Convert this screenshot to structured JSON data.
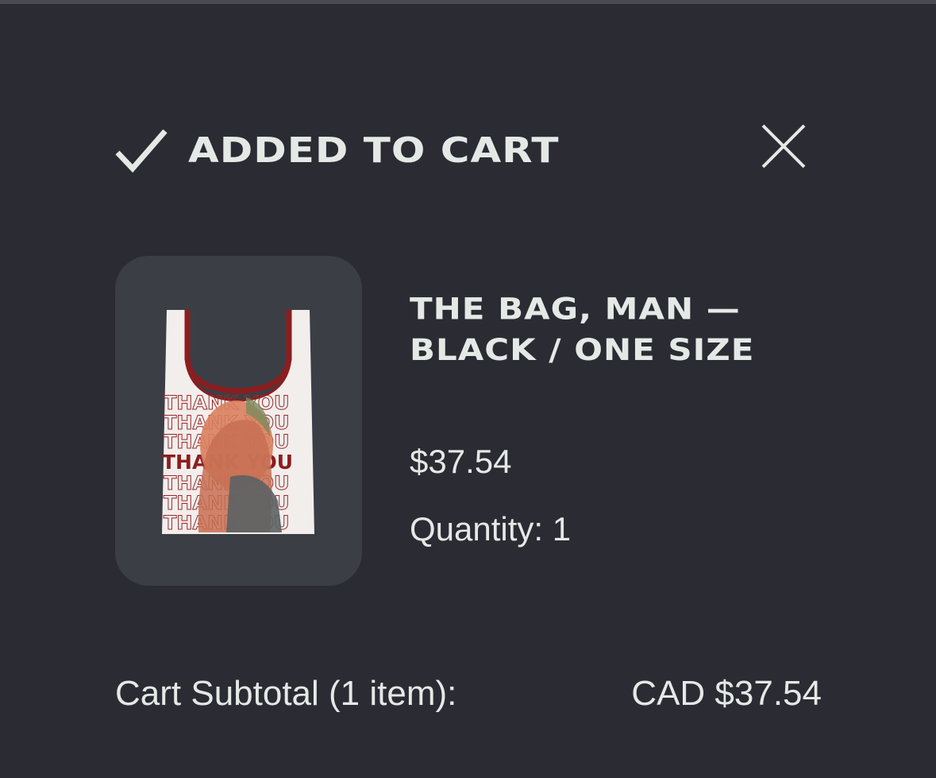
{
  "header": {
    "title": "ADDED TO CART",
    "check_icon": "checkmark-icon",
    "close_icon": "close-icon"
  },
  "product": {
    "image_alt": "Thank You tote bag",
    "name": "THE BAG, MAN — BLACK / ONE SIZE",
    "price": "$37.54",
    "quantity_label": "Quantity:",
    "quantity_value": "1"
  },
  "subtotal": {
    "label": "Cart Subtotal (1 item):",
    "value": "CAD $37.54"
  },
  "colors": {
    "background": "#2b2c33",
    "thumb_background": "#3c3e46",
    "text": "#e4e9e6",
    "bag_accent": "#8b1e1e"
  }
}
